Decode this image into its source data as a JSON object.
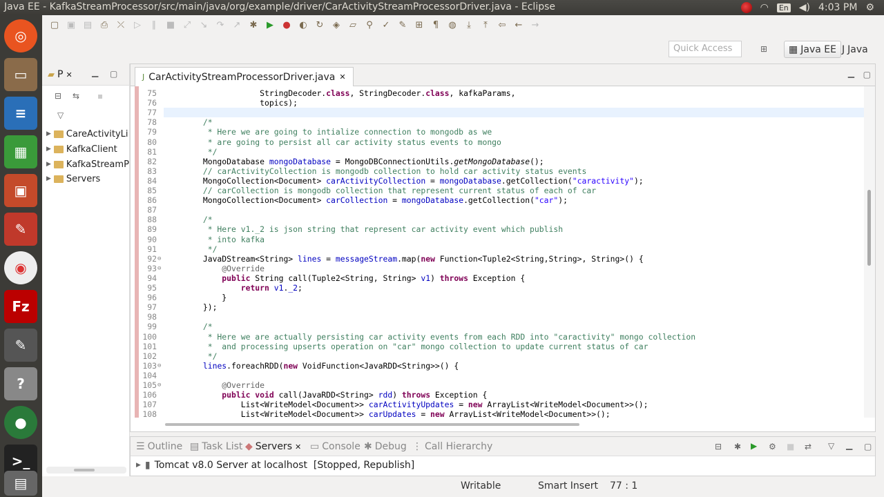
{
  "window": {
    "title": "Java EE - KafkaStreamProcessor/src/main/java/org/example/driver/CarActivityStreamProcessorDriver.java - Eclipse",
    "clock": "4:03 PM",
    "lang": "En"
  },
  "toolbar": {
    "quick_access_placeholder": "Quick Access",
    "perspectives": [
      "Java EE",
      "Java"
    ]
  },
  "project_explorer": {
    "tab_label": "P",
    "items": [
      "CareActivityLi",
      "KafkaClient",
      "KafkaStreamP",
      "Servers"
    ]
  },
  "editor": {
    "tab_label": "CarActivityStreamProcessorDriver.java",
    "current_line": "77",
    "lines": [
      {
        "n": "75",
        "html": "                    StringDecoder.<span class=\"kw\">class</span>, StringDecoder.<span class=\"kw\">class</span>, kafkaParams,"
      },
      {
        "n": "76",
        "html": "                    topics);"
      },
      {
        "n": "77",
        "html": ""
      },
      {
        "n": "78",
        "html": "        <span class=\"cm\">/*</span>"
      },
      {
        "n": "79",
        "html": "<span class=\"cm\">         * Here we are going to intialize connection to mongodb as we</span>"
      },
      {
        "n": "80",
        "html": "<span class=\"cm\">         * are going to persist all car activity status events to mongo</span>"
      },
      {
        "n": "81",
        "html": "<span class=\"cm\">         */</span>"
      },
      {
        "n": "82",
        "html": "        MongoDatabase <span class=\"fd\">mongoDatabase</span> = MongoDBConnectionUtils.<span class=\"it\">getMongoDatabase</span>();"
      },
      {
        "n": "83",
        "html": "        <span class=\"cm\">// carActivityCollection is mongodb collection to hold car activity status events</span>"
      },
      {
        "n": "84",
        "html": "        MongoCollection&lt;Document&gt; <span class=\"fd\">carActivityCollection</span> = <span class=\"fd\">mongoDatabase</span>.getCollection(<span class=\"st\">\"caractivity\"</span>);"
      },
      {
        "n": "85",
        "html": "        <span class=\"cm\">// carCollection is mongodb collection that represent current status of each of car</span>"
      },
      {
        "n": "86",
        "html": "        MongoCollection&lt;Document&gt; <span class=\"fd\">carCollection</span> = <span class=\"fd\">mongoDatabase</span>.getCollection(<span class=\"st\">\"car\"</span>);"
      },
      {
        "n": "87",
        "html": ""
      },
      {
        "n": "88",
        "html": "        <span class=\"cm\">/*</span>"
      },
      {
        "n": "89",
        "html": "<span class=\"cm\">         * Here v1._2 is json string that represent car activity event which publish</span>"
      },
      {
        "n": "90",
        "html": "<span class=\"cm\">         * into kafka</span>"
      },
      {
        "n": "91",
        "html": "<span class=\"cm\">         */</span>"
      },
      {
        "n": "92",
        "html": "        JavaDStream&lt;String&gt; <span class=\"fd\">lines</span> = <span class=\"fd\">messageStream</span>.map(<span class=\"kw\">new</span> Function&lt;Tuple2&lt;String,String&gt;, String&gt;() {"
      },
      {
        "n": "93",
        "html": "            <span class=\"an\">@Override</span>"
      },
      {
        "n": "94",
        "html": "            <span class=\"kw\">public</span> String call(Tuple2&lt;String, String&gt; <span class=\"fd\">v1</span>) <span class=\"kw\">throws</span> Exception {"
      },
      {
        "n": "95",
        "html": "                <span class=\"kw\">return</span> <span class=\"fd\">v1</span>.<span class=\"fd\">_2</span>;"
      },
      {
        "n": "96",
        "html": "            }"
      },
      {
        "n": "97",
        "html": "        });"
      },
      {
        "n": "98",
        "html": ""
      },
      {
        "n": "99",
        "html": "        <span class=\"cm\">/*</span>"
      },
      {
        "n": "100",
        "html": "<span class=\"cm\">         * Here we are actually persisting car activity events from each RDD into \"caractivity\" mongo collection</span>"
      },
      {
        "n": "101",
        "html": "<span class=\"cm\">         *  and processing upserts operation on \"car\" mongo collection to update current status of car</span>"
      },
      {
        "n": "102",
        "html": "<span class=\"cm\">         */</span>"
      },
      {
        "n": "103",
        "html": "        <span class=\"fd\">lines</span>.foreachRDD(<span class=\"kw\">new</span> VoidFunction&lt;JavaRDD&lt;String&gt;&gt;() {"
      },
      {
        "n": "104",
        "html": ""
      },
      {
        "n": "105",
        "html": "            <span class=\"an\">@Override</span>"
      },
      {
        "n": "106",
        "html": "            <span class=\"kw\">public void</span> call(JavaRDD&lt;String&gt; <span class=\"fd\">rdd</span>) <span class=\"kw\">throws</span> Exception {"
      },
      {
        "n": "107",
        "html": "                List&lt;WriteModel&lt;Document&gt;&gt; <span class=\"fd\">carActivityUpdates</span> = <span class=\"kw\">new</span> ArrayList&lt;WriteModel&lt;Document&gt;&gt;();"
      },
      {
        "n": "108",
        "html": "                List&lt;WriteModel&lt;Document&gt;&gt; <span class=\"fd\">carUpdates</span> = <span class=\"kw\">new</span> ArrayList&lt;WriteModel&lt;Document&gt;&gt;();"
      }
    ]
  },
  "bottom_panel": {
    "tabs": [
      "Outline",
      "Task List",
      "Servers",
      "Console",
      "Debug",
      "Call Hierarchy"
    ],
    "active_tab": "Servers",
    "server_row": "Tomcat v8.0 Server at localhost  [Stopped, Republish]"
  },
  "status_bar": {
    "mode": "Writable",
    "insert": "Smart Insert",
    "position": "77 : 1"
  }
}
